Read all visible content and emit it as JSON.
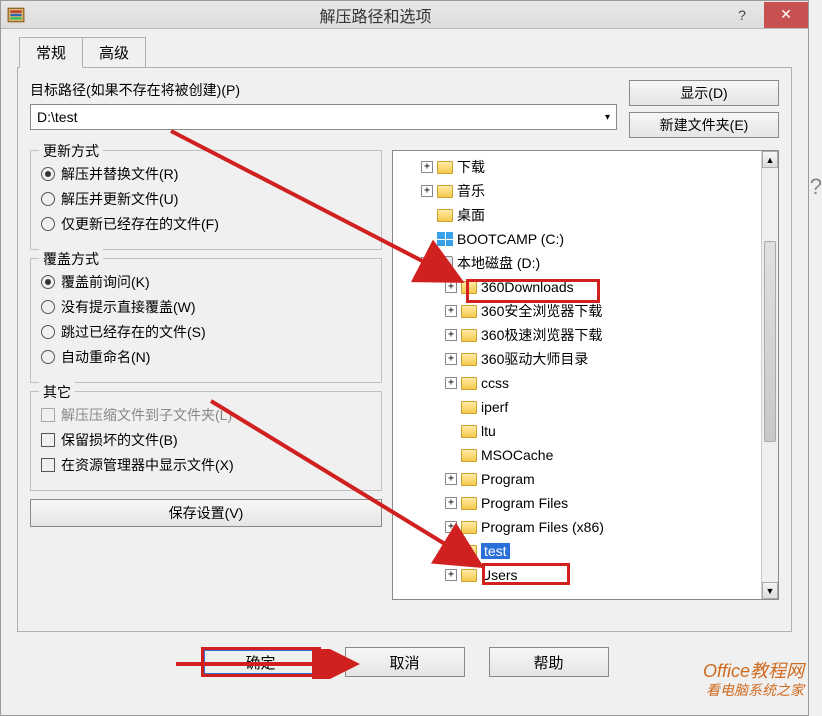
{
  "titlebar": {
    "title": "解压路径和选项"
  },
  "tabs": {
    "general": "常规",
    "advanced": "高级"
  },
  "path": {
    "label": "目标路径(如果不存在将被创建)(P)",
    "value": "D:\\test"
  },
  "buttons": {
    "show": "显示(D)",
    "newFolder": "新建文件夹(E)"
  },
  "update": {
    "title": "更新方式",
    "replace": "解压并替换文件(R)",
    "updateNew": "解压并更新文件(U)",
    "existingOnly": "仅更新已经存在的文件(F)"
  },
  "overwrite": {
    "title": "覆盖方式",
    "ask": "覆盖前询问(K)",
    "noPrompt": "没有提示直接覆盖(W)",
    "skip": "跳过已经存在的文件(S)",
    "autoRename": "自动重命名(N)"
  },
  "other": {
    "title": "其它",
    "subfolder": "解压压缩文件到子文件夹(L)",
    "keepBroken": "保留损坏的文件(B)",
    "showInExplorer": "在资源管理器中显示文件(X)"
  },
  "saveSettings": "保存设置(V)",
  "tree": [
    {
      "indent": 28,
      "exp": "plus",
      "icon": "folder",
      "label": "下载"
    },
    {
      "indent": 28,
      "exp": "plus",
      "icon": "folder",
      "label": "音乐"
    },
    {
      "indent": 28,
      "exp": "none",
      "icon": "folder",
      "label": "桌面"
    },
    {
      "indent": 28,
      "exp": "none",
      "icon": "win",
      "label": "BOOTCAMP (C:)"
    },
    {
      "indent": 28,
      "exp": "minus",
      "icon": "drive",
      "label": "本地磁盘 (D:)",
      "highlight": true
    },
    {
      "indent": 52,
      "exp": "plus",
      "icon": "folder",
      "label": "360Downloads"
    },
    {
      "indent": 52,
      "exp": "plus",
      "icon": "folder",
      "label": "360安全浏览器下载"
    },
    {
      "indent": 52,
      "exp": "plus",
      "icon": "folder",
      "label": "360极速浏览器下载"
    },
    {
      "indent": 52,
      "exp": "plus",
      "icon": "folder",
      "label": "360驱动大师目录"
    },
    {
      "indent": 52,
      "exp": "plus",
      "icon": "folder",
      "label": "ccss"
    },
    {
      "indent": 52,
      "exp": "none",
      "icon": "folder",
      "label": "iperf"
    },
    {
      "indent": 52,
      "exp": "none",
      "icon": "folder",
      "label": "ltu"
    },
    {
      "indent": 52,
      "exp": "none",
      "icon": "folder",
      "label": "MSOCache"
    },
    {
      "indent": 52,
      "exp": "plus",
      "icon": "folder",
      "label": "Program"
    },
    {
      "indent": 52,
      "exp": "plus",
      "icon": "folder",
      "label": "Program Files"
    },
    {
      "indent": 52,
      "exp": "plus",
      "icon": "folder",
      "label": "Program Files (x86)"
    },
    {
      "indent": 52,
      "exp": "none",
      "icon": "folder",
      "label": "test",
      "selected": true
    },
    {
      "indent": 52,
      "exp": "plus",
      "icon": "folder",
      "label": "Users"
    }
  ],
  "dialog": {
    "ok": "确定",
    "cancel": "取消",
    "help": "帮助"
  },
  "watermark": {
    "line1": "Office教程网",
    "line2": "看电脑系统之家"
  },
  "external_q": "?"
}
